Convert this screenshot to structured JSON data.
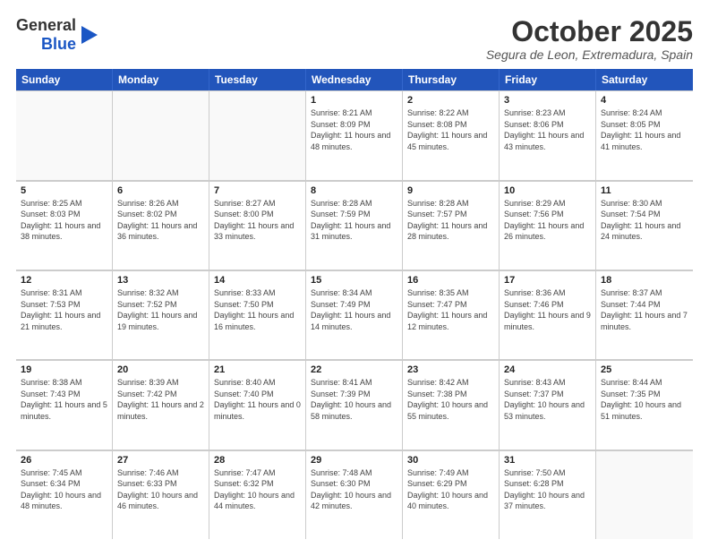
{
  "header": {
    "logo_general": "General",
    "logo_blue": "Blue",
    "month_title": "October 2025",
    "location": "Segura de Leon, Extremadura, Spain"
  },
  "weekdays": [
    "Sunday",
    "Monday",
    "Tuesday",
    "Wednesday",
    "Thursday",
    "Friday",
    "Saturday"
  ],
  "weeks": [
    [
      {
        "day": "",
        "info": ""
      },
      {
        "day": "",
        "info": ""
      },
      {
        "day": "",
        "info": ""
      },
      {
        "day": "1",
        "info": "Sunrise: 8:21 AM\nSunset: 8:09 PM\nDaylight: 11 hours and 48 minutes."
      },
      {
        "day": "2",
        "info": "Sunrise: 8:22 AM\nSunset: 8:08 PM\nDaylight: 11 hours and 45 minutes."
      },
      {
        "day": "3",
        "info": "Sunrise: 8:23 AM\nSunset: 8:06 PM\nDaylight: 11 hours and 43 minutes."
      },
      {
        "day": "4",
        "info": "Sunrise: 8:24 AM\nSunset: 8:05 PM\nDaylight: 11 hours and 41 minutes."
      }
    ],
    [
      {
        "day": "5",
        "info": "Sunrise: 8:25 AM\nSunset: 8:03 PM\nDaylight: 11 hours and 38 minutes."
      },
      {
        "day": "6",
        "info": "Sunrise: 8:26 AM\nSunset: 8:02 PM\nDaylight: 11 hours and 36 minutes."
      },
      {
        "day": "7",
        "info": "Sunrise: 8:27 AM\nSunset: 8:00 PM\nDaylight: 11 hours and 33 minutes."
      },
      {
        "day": "8",
        "info": "Sunrise: 8:28 AM\nSunset: 7:59 PM\nDaylight: 11 hours and 31 minutes."
      },
      {
        "day": "9",
        "info": "Sunrise: 8:28 AM\nSunset: 7:57 PM\nDaylight: 11 hours and 28 minutes."
      },
      {
        "day": "10",
        "info": "Sunrise: 8:29 AM\nSunset: 7:56 PM\nDaylight: 11 hours and 26 minutes."
      },
      {
        "day": "11",
        "info": "Sunrise: 8:30 AM\nSunset: 7:54 PM\nDaylight: 11 hours and 24 minutes."
      }
    ],
    [
      {
        "day": "12",
        "info": "Sunrise: 8:31 AM\nSunset: 7:53 PM\nDaylight: 11 hours and 21 minutes."
      },
      {
        "day": "13",
        "info": "Sunrise: 8:32 AM\nSunset: 7:52 PM\nDaylight: 11 hours and 19 minutes."
      },
      {
        "day": "14",
        "info": "Sunrise: 8:33 AM\nSunset: 7:50 PM\nDaylight: 11 hours and 16 minutes."
      },
      {
        "day": "15",
        "info": "Sunrise: 8:34 AM\nSunset: 7:49 PM\nDaylight: 11 hours and 14 minutes."
      },
      {
        "day": "16",
        "info": "Sunrise: 8:35 AM\nSunset: 7:47 PM\nDaylight: 11 hours and 12 minutes."
      },
      {
        "day": "17",
        "info": "Sunrise: 8:36 AM\nSunset: 7:46 PM\nDaylight: 11 hours and 9 minutes."
      },
      {
        "day": "18",
        "info": "Sunrise: 8:37 AM\nSunset: 7:44 PM\nDaylight: 11 hours and 7 minutes."
      }
    ],
    [
      {
        "day": "19",
        "info": "Sunrise: 8:38 AM\nSunset: 7:43 PM\nDaylight: 11 hours and 5 minutes."
      },
      {
        "day": "20",
        "info": "Sunrise: 8:39 AM\nSunset: 7:42 PM\nDaylight: 11 hours and 2 minutes."
      },
      {
        "day": "21",
        "info": "Sunrise: 8:40 AM\nSunset: 7:40 PM\nDaylight: 11 hours and 0 minutes."
      },
      {
        "day": "22",
        "info": "Sunrise: 8:41 AM\nSunset: 7:39 PM\nDaylight: 10 hours and 58 minutes."
      },
      {
        "day": "23",
        "info": "Sunrise: 8:42 AM\nSunset: 7:38 PM\nDaylight: 10 hours and 55 minutes."
      },
      {
        "day": "24",
        "info": "Sunrise: 8:43 AM\nSunset: 7:37 PM\nDaylight: 10 hours and 53 minutes."
      },
      {
        "day": "25",
        "info": "Sunrise: 8:44 AM\nSunset: 7:35 PM\nDaylight: 10 hours and 51 minutes."
      }
    ],
    [
      {
        "day": "26",
        "info": "Sunrise: 7:45 AM\nSunset: 6:34 PM\nDaylight: 10 hours and 48 minutes."
      },
      {
        "day": "27",
        "info": "Sunrise: 7:46 AM\nSunset: 6:33 PM\nDaylight: 10 hours and 46 minutes."
      },
      {
        "day": "28",
        "info": "Sunrise: 7:47 AM\nSunset: 6:32 PM\nDaylight: 10 hours and 44 minutes."
      },
      {
        "day": "29",
        "info": "Sunrise: 7:48 AM\nSunset: 6:30 PM\nDaylight: 10 hours and 42 minutes."
      },
      {
        "day": "30",
        "info": "Sunrise: 7:49 AM\nSunset: 6:29 PM\nDaylight: 10 hours and 40 minutes."
      },
      {
        "day": "31",
        "info": "Sunrise: 7:50 AM\nSunset: 6:28 PM\nDaylight: 10 hours and 37 minutes."
      },
      {
        "day": "",
        "info": ""
      }
    ]
  ]
}
